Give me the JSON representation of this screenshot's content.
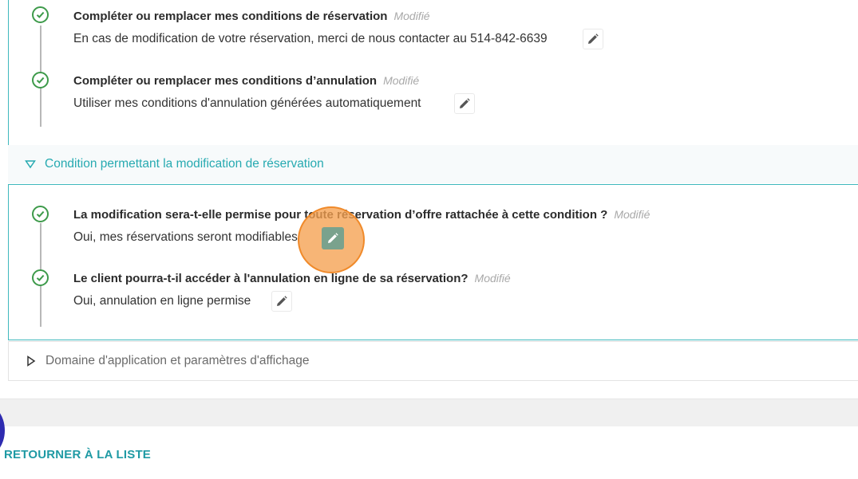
{
  "steps": [
    {
      "title": "Compléter ou remplacer mes conditions de réservation",
      "modified": "Modifié",
      "value": "En cas de modification de votre réservation, merci de nous contacter au 514-842-6639"
    },
    {
      "title": "Compléter ou remplacer mes conditions d’annulation",
      "modified": "Modifié",
      "value": "Utiliser mes conditions d'annulation générées automatiquement"
    },
    {
      "title": "La modification sera-t-elle permise pour toute réservation d’offre rattachée à cette condition ?",
      "modified": "Modifié",
      "value": "Oui, mes réservations seront modifiables"
    },
    {
      "title": "Le client pourra-t-il accéder à l'annulation en ligne de sa réservation?",
      "modified": "Modifié",
      "value": "Oui, annulation en ligne permise"
    }
  ],
  "sections": {
    "modification": "Condition permettant la modification de réservation",
    "domain": "Domaine d'application et paramètres d'affichage"
  },
  "footer": {
    "back_label": "RETOURNER À LA LISTE"
  },
  "colors": {
    "accent": "#27aab1",
    "check": "#3d9a4a",
    "highlight": "#f08a2a"
  }
}
